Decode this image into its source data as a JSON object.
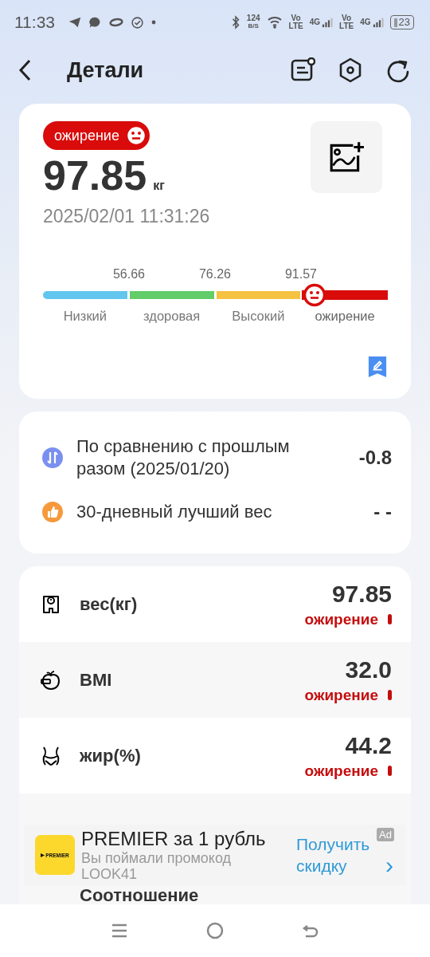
{
  "status_bar": {
    "time": "11:33",
    "net_speed": "124",
    "net_unit": "B/S",
    "sim": [
      {
        "volte_top": "Vo",
        "volte_bottom": "LTE",
        "network": "4G"
      },
      {
        "volte_top": "Vo",
        "volte_bottom": "LTE",
        "network": "4G"
      }
    ],
    "battery": "23"
  },
  "header": {
    "title": "Детали",
    "actions": [
      {
        "kind": "report"
      },
      {
        "kind": "settings"
      },
      {
        "kind": "share"
      }
    ]
  },
  "summary": {
    "badge": "ожирение",
    "weight": "97.85",
    "unit": "кг",
    "datetime": "2025/02/01 11:31:26",
    "meter": {
      "thresholds": [
        "56.66",
        "76.26",
        "91.57"
      ],
      "level": 0.79,
      "segments": [
        {
          "label": "Низкий",
          "color": "#62c6ee",
          "selected": false
        },
        {
          "label": "здоровая",
          "color": "#62cd69",
          "selected": false
        },
        {
          "label": "Высокий",
          "color": "#f5c242",
          "selected": false
        },
        {
          "label": "ожирение",
          "color": "#d90b0b",
          "selected": true
        }
      ]
    }
  },
  "comparison": [
    {
      "kind": "compare",
      "label": "По сравнению с прошлым разом (2025/01/20)",
      "value": "-0.8"
    },
    {
      "kind": "best",
      "label": "30-дневный лучший вес",
      "value": "- -"
    }
  ],
  "metrics": [
    {
      "kind": "scale",
      "label": "вес(кг)",
      "value": "97.85",
      "status": "ожирение"
    },
    {
      "kind": "apple",
      "label": "BMI",
      "value": "32.0",
      "status": "ожирение"
    },
    {
      "kind": "waist",
      "label": "жир(%)",
      "value": "44.2",
      "status": "ожирение"
    },
    {
      "kind": "partial",
      "label": "Соотношение"
    }
  ],
  "ad": {
    "logo": "PREMIER",
    "title": "PREMIER за 1 рубль",
    "text": "Вы поймали промокод LOOK41",
    "cta": "Получить скидку",
    "badge": "Ad",
    "chevron": "›"
  }
}
